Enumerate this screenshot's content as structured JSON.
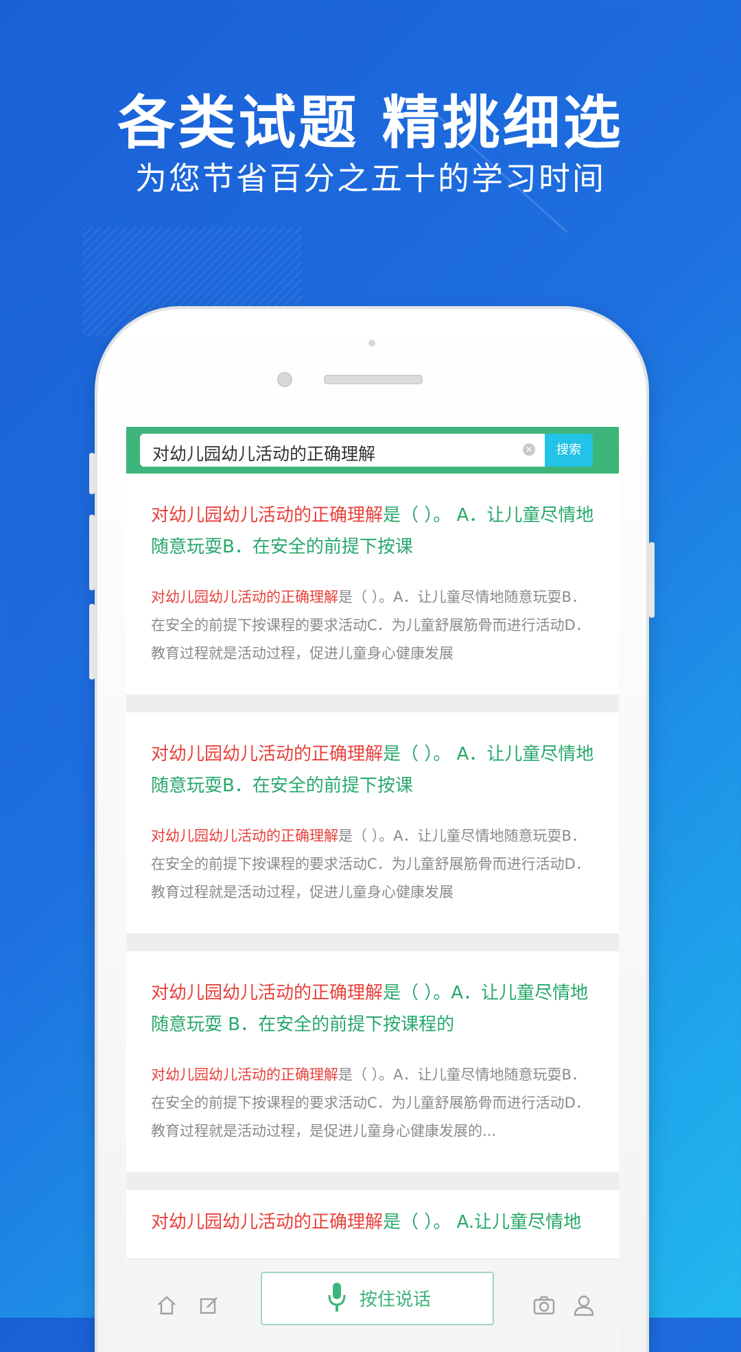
{
  "promo": {
    "headline": "各类试题 精挑细选",
    "subline": "为您节省百分之五十的学习时间"
  },
  "search": {
    "query": "对幼儿园幼儿活动的正确理解",
    "button_label": "搜索"
  },
  "results": [
    {
      "title_highlight": "对幼儿园幼儿活动的正确理解",
      "title_rest": "是（ ）。 A．让儿童尽情地随意玩耍B．在安全的前提下按课",
      "body_highlight": "对幼儿园幼儿活动的正确理解",
      "body_rest": "是（ ）。A．让儿童尽情地随意玩耍B．在安全的前提下按课程的要求活动C．为儿童舒展筋骨而进行活动D．教育过程就是活动过程，促进儿童身心健康发展"
    },
    {
      "title_highlight": "对幼儿园幼儿活动的正确理解",
      "title_rest": "是（ ）。 A．让儿童尽情地随意玩耍B．在安全的前提下按课",
      "body_highlight": "对幼儿园幼儿活动的正确理解",
      "body_rest": "是（ ）。A．让儿童尽情地随意玩耍B．在安全的前提下按课程的要求活动C．为儿童舒展筋骨而进行活动D．教育过程就是活动过程，促进儿童身心健康发展"
    },
    {
      "title_highlight": "对幼儿园幼儿活动的正确理解",
      "title_rest": "是（ ）。A．让儿童尽情地随意玩耍 B．在安全的前提下按课程的",
      "body_highlight": "对幼儿园幼儿活动的正确理解",
      "body_rest": "是（ ）。A．让儿童尽情地随意玩耍B．在安全的前提下按课程的要求活动C．为儿童舒展筋骨而进行活动D．教育过程就是活动过程，是促进儿童身心健康发展的..."
    },
    {
      "title_highlight": "对幼儿园幼儿活动的正确理解",
      "title_rest": "是（ ）。 A.让儿童尽情地"
    }
  ],
  "bottom_bar": {
    "voice_label": "按住说话",
    "icons": [
      "home-icon",
      "edit-icon",
      "microphone-icon",
      "camera-icon",
      "user-icon"
    ]
  },
  "colors": {
    "background": "#1e6fe0",
    "accent_green": "#3db57a",
    "highlight_red": "#e8413b",
    "search_button": "#22c3e6"
  }
}
